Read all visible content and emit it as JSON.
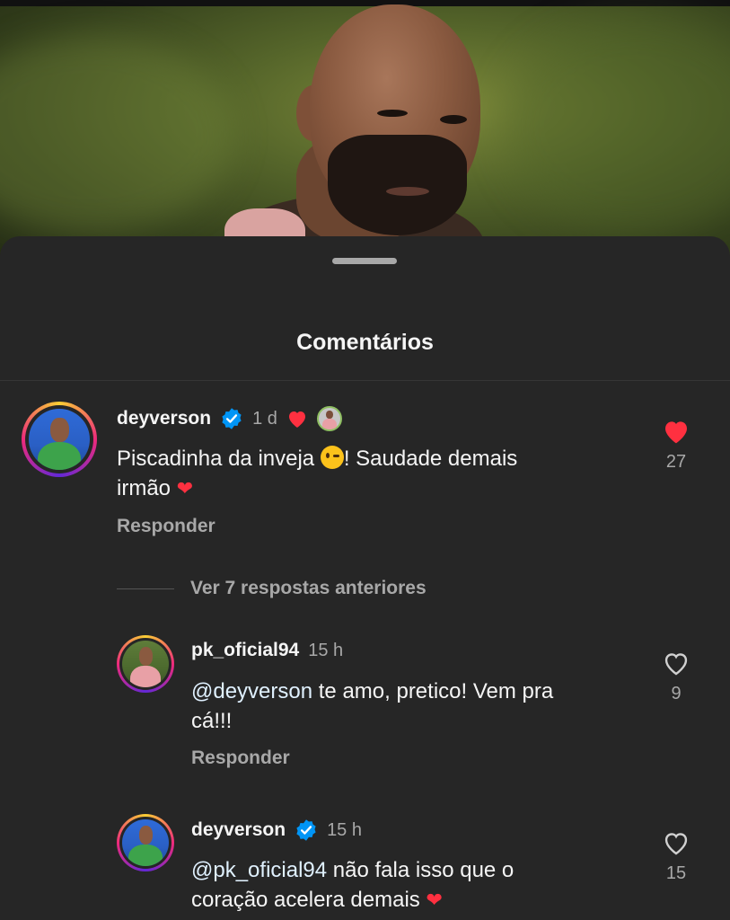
{
  "sheet": {
    "title": "Comentários"
  },
  "comments": [
    {
      "username": "deyverson",
      "time": "1 d",
      "text_before": "Piscadinha da inveja ",
      "text_after": "! Saudade demais",
      "text_line2": "irmão ",
      "reply": "Responder",
      "likes": "27"
    },
    {
      "username": "pk_oficial94",
      "time": "15 h",
      "mention": "@deyverson",
      "text_line1": " te amo, pretico! Vem pra",
      "text_line2": "cá!!!",
      "reply": "Responder",
      "likes": "9"
    },
    {
      "username": "deyverson",
      "time": "15 h",
      "mention": "@pk_oficial94",
      "text_line1": " não fala isso que o",
      "text_line2": "coração acelera demais ",
      "likes": "15"
    }
  ],
  "view_replies": "Ver 7 respostas anteriores",
  "icons": {
    "verified": "verified-badge-icon",
    "heart_filled": "heart-filled-icon",
    "heart_outline": "heart-outline-icon",
    "wink_emoji": "winking-face-emoji",
    "heart_emoji": "red-heart-emoji"
  },
  "colors": {
    "accent_heart": "#ff3040",
    "verified_blue": "#0095f6",
    "background": "#262626"
  }
}
